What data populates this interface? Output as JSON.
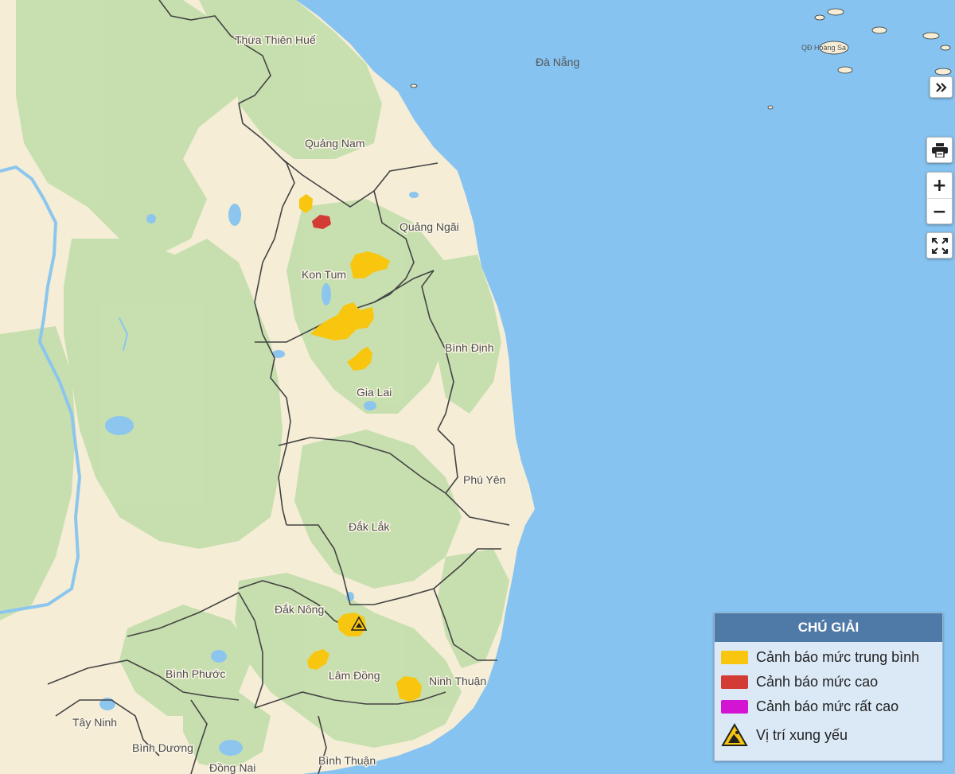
{
  "map": {
    "labels": {
      "thua_thien_hue": "Thừa Thiên Huế",
      "da_nang": "Đà Nẵng",
      "hoang_sa": "QĐ Hoàng Sa",
      "quang_nam": "Quảng Nam",
      "quang_ngai": "Quảng Ngãi",
      "kon_tum": "Kon Tum",
      "binh_dinh": "Bình Định",
      "gia_lai": "Gia Lai",
      "phu_yen": "Phú Yên",
      "dak_lak": "Đắk Lắk",
      "dak_nong": "Đắk Nông",
      "lam_dong": "Lâm Đồng",
      "ninh_thuan": "Ninh Thuận",
      "binh_phuoc": "Bình Phước",
      "tay_ninh": "Tây Ninh",
      "binh_duong": "Bình Dương",
      "dong_nai": "Đồng Nai",
      "binh_thuan": "Bình Thuận"
    },
    "colors": {
      "sea": "#86c3f0",
      "land": "#f5edd6",
      "forest": "#c5dfad",
      "warning_medium": "#f8c60f",
      "warning_high": "#d33b35",
      "warning_very_high": "#d315d3"
    }
  },
  "controls": {
    "expand_icon": "chevron-double-right-icon",
    "print_icon": "printer-icon",
    "zoom_in_label": "+",
    "zoom_out_label": "−",
    "fullscreen_icon": "fullscreen-icon"
  },
  "legend": {
    "title": "CHÚ GIẢI",
    "items": [
      {
        "label": "Cảnh báo mức trung bình",
        "color": "#f8c60f"
      },
      {
        "label": "Cảnh báo mức cao",
        "color": "#d33b35"
      },
      {
        "label": "Cảnh báo mức rất cao",
        "color": "#d315d3"
      },
      {
        "label": "Vị trí xung yếu",
        "icon": "landslide-warning-icon"
      }
    ]
  }
}
